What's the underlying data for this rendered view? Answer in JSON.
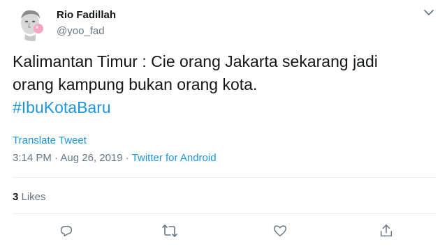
{
  "tweet": {
    "author_name": "Rio Fadillah",
    "author_handle": "@yoo_fad",
    "text_line1": "Kalimantan Timur : Cie orang Jakarta sekarang jadi",
    "text_line2": "orang kampung bukan orang kota.",
    "hashtag": "#IbuKotaBaru",
    "translate_label": "Translate Tweet",
    "timestamp": "3:14 PM · Aug 26, 2019 · ",
    "source": "Twitter for Android",
    "likes_count": "3",
    "likes_label": " Likes"
  },
  "icons": {
    "caret": "chevron-down-icon",
    "reply": "reply-icon",
    "retweet": "retweet-icon",
    "like": "heart-icon",
    "share": "share-icon"
  },
  "colors": {
    "link": "#1b95e0",
    "secondary_text": "#657786",
    "primary_text": "#14171a",
    "divider": "#e6ecf0"
  }
}
